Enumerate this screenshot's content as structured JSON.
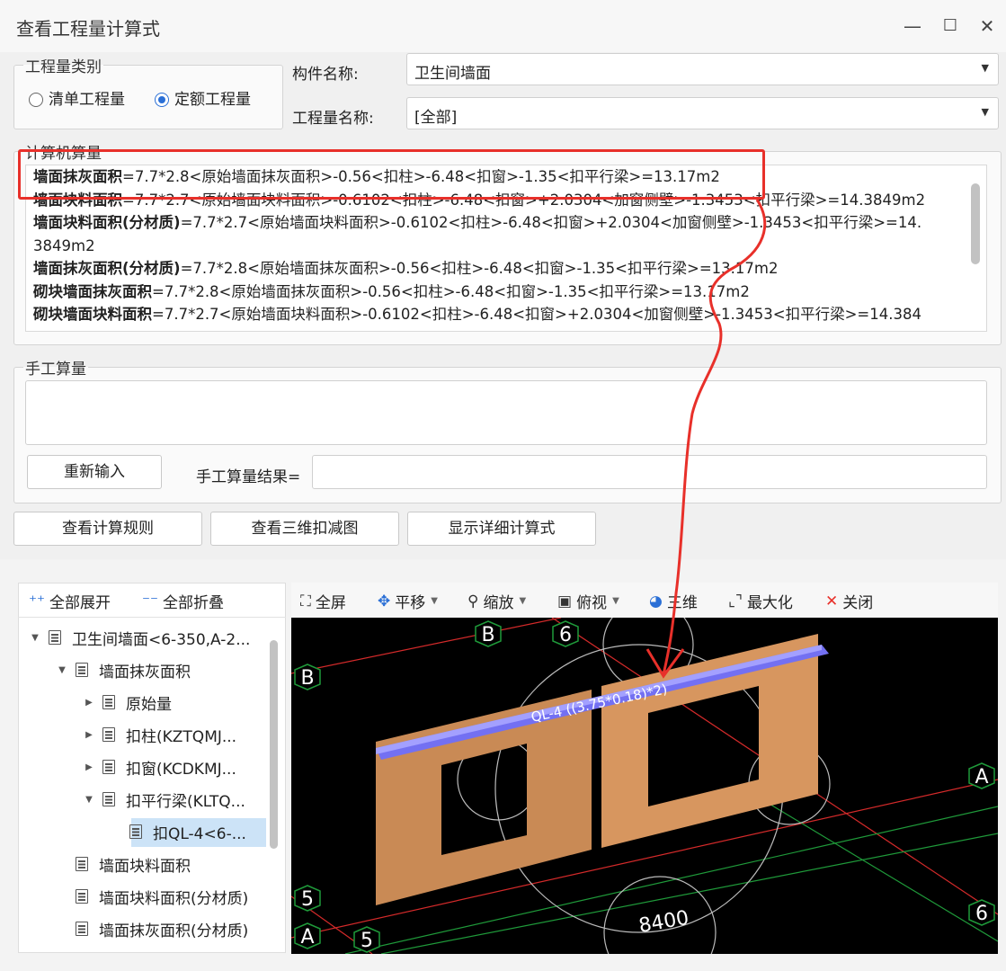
{
  "window": {
    "title": "查看工程量计算式",
    "min": "—",
    "max": "☐",
    "close": "✕"
  },
  "qty_type": {
    "legend": "工程量类别",
    "opt1": "清单工程量",
    "opt2": "定额工程量",
    "selected": "定额工程量"
  },
  "component": {
    "label": "构件名称:",
    "value": "卫生间墙面"
  },
  "qty_name": {
    "label": "工程量名称:",
    "value": "[全部]"
  },
  "computer": {
    "legend": "计算机算量",
    "lines": [
      {
        "name": "墙面抹灰面积",
        "expr": "=7.7*2.8<原始墙面抹灰面积>-0.56<扣柱>-6.48<扣窗>-1.35<扣平行梁>=13.17m2"
      },
      {
        "name": "墙面块料面积",
        "expr": "=7.7*2.7<原始墙面块料面积>-0.6102<扣柱>-6.48<扣窗>+2.0304<加窗侧壁>-1.3453<扣平行梁>=14.3849m2"
      },
      {
        "name": "墙面块料面积(分材质)",
        "expr": "=7.7*2.7<原始墙面块料面积>-0.6102<扣柱>-6.48<扣窗>+2.0304<加窗侧壁>-1.3453<扣平行梁>=14."
      },
      {
        "name": "",
        "expr": "3849m2"
      },
      {
        "name": "墙面抹灰面积(分材质)",
        "expr": "=7.7*2.8<原始墙面抹灰面积>-0.56<扣柱>-6.48<扣窗>-1.35<扣平行梁>=13.17m2"
      },
      {
        "name": "砌块墙面抹灰面积",
        "expr": "=7.7*2.8<原始墙面抹灰面积>-0.56<扣柱>-6.48<扣窗>-1.35<扣平行梁>=13.17m2"
      },
      {
        "name": "砌块墙面块料面积",
        "expr": "=7.7*2.7<原始墙面块料面积>-0.6102<扣柱>-6.48<扣窗>+2.0304<加窗侧壁>-1.3453<扣平行梁>=14.384"
      }
    ]
  },
  "manual": {
    "legend": "手工算量",
    "reinput": "重新输入",
    "result_label": "手工算量结果=",
    "result_value": ""
  },
  "actions": {
    "rules": "查看计算规则",
    "view3d": "查看三维扣减图",
    "detail": "显示详细计算式"
  },
  "tree_toolbar": {
    "expand": "全部展开",
    "collapse": "全部折叠"
  },
  "tree": [
    {
      "label": "卫生间墙面<6-350,A-2...",
      "level": 0,
      "arrow": "down"
    },
    {
      "label": "墙面抹灰面积",
      "level": 1,
      "arrow": "down"
    },
    {
      "label": "原始量",
      "level": 2,
      "arrow": "right"
    },
    {
      "label": "扣柱(KZTQMJ...",
      "level": 2,
      "arrow": "right"
    },
    {
      "label": "扣窗(KCDKMJ...",
      "level": 2,
      "arrow": "right"
    },
    {
      "label": "扣平行梁(KLTQ...",
      "level": 2,
      "arrow": "down"
    },
    {
      "label": "扣QL-4<6-...",
      "level": 3,
      "arrow": "",
      "selected": true
    },
    {
      "label": "墙面块料面积",
      "level": 1,
      "arrow": ""
    },
    {
      "label": "墙面块料面积(分材质)",
      "level": 1,
      "arrow": ""
    },
    {
      "label": "墙面抹灰面积(分材质)",
      "level": 1,
      "arrow": ""
    }
  ],
  "viewer_toolbar": {
    "fullscreen": "全屏",
    "pan": "平移",
    "zoom": "缩放",
    "top": "俯视",
    "three_d": "三维",
    "maximize": "最大化",
    "close": "关闭"
  },
  "viewer": {
    "axis_labels": [
      "B",
      "6",
      "B",
      "A",
      "5",
      "A",
      "5",
      "6"
    ],
    "beam_label": "QL-4 ((3.75*0.18)*2)",
    "dimension": "8400"
  },
  "colors": {
    "highlight": "#e8302a",
    "accent": "#2a6fd6",
    "wall": "#c98a55",
    "beam": "#6f6cf0"
  }
}
